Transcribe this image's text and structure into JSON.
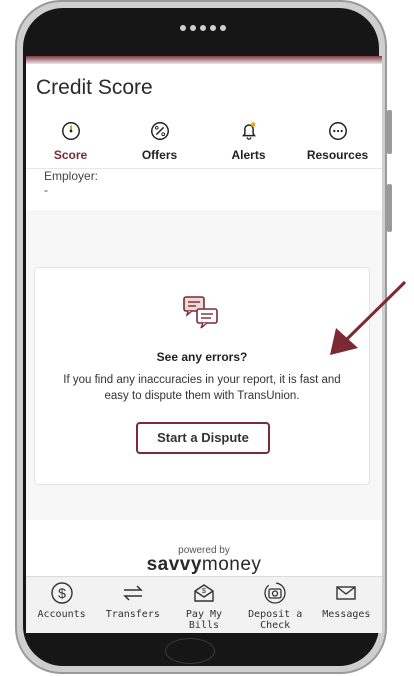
{
  "header": {
    "title": "Credit Score"
  },
  "tabs": [
    {
      "label": "Score",
      "icon": "gauge-icon"
    },
    {
      "label": "Offers",
      "icon": "percent-icon"
    },
    {
      "label": "Alerts",
      "icon": "bell-icon"
    },
    {
      "label": "Resources",
      "icon": "more-icon"
    }
  ],
  "report": {
    "employer_label": "Employer:",
    "employer_value": "-"
  },
  "dispute_card": {
    "title": "See any errors?",
    "text": "If you find any inaccuracies in your report, it is fast and easy to dispute them with TransUnion.",
    "button_label": "Start a Dispute"
  },
  "branding": {
    "powered_by": "powered by",
    "brand_bold": "savvy",
    "brand_light": "money"
  },
  "bottom_nav": [
    {
      "label": "Accounts",
      "icon": "dollar-icon"
    },
    {
      "label": "Transfers",
      "icon": "transfer-icon"
    },
    {
      "label": "Pay My Bills",
      "icon": "bills-icon"
    },
    {
      "label": "Deposit a Check",
      "icon": "camera-icon"
    },
    {
      "label": "Messages",
      "icon": "envelope-icon"
    }
  ],
  "colors": {
    "accent": "#7a2b35",
    "arrow": "#7b2a35"
  }
}
